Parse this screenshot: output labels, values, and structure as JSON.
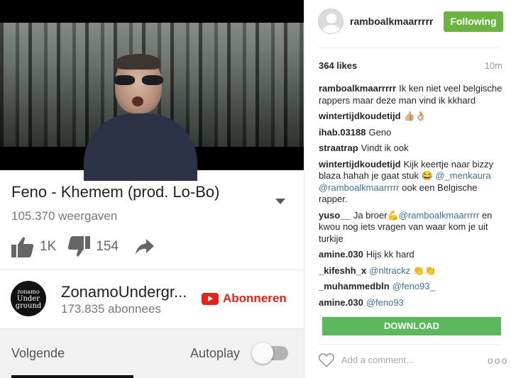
{
  "youtube": {
    "video_title": "Feno - Khemem (prod. Lo-Bo)",
    "views": "105.370 weergaven",
    "likes": "1K",
    "dislikes": "154",
    "channel": {
      "avatar_text_1": "zonamo",
      "avatar_text_2": "Under",
      "avatar_text_3": "ground",
      "name": "ZonamoUndergr...",
      "subscribers": "173.835 abonnees",
      "subscribe_label": "Abonneren"
    },
    "next_label": "Volgende",
    "autoplay_label": "Autoplay",
    "autoplay_on": false
  },
  "instagram": {
    "username": "ramboalkmaarrrrr",
    "follow_label": "Following",
    "likes": "364 likes",
    "time": "10m",
    "comments": [
      {
        "user": "ramboalkmaarrrrr",
        "text": "Ik ken niet veel belgische rappers maar deze man vind ik kkhard"
      },
      {
        "user": "wintertijdkoudetijd",
        "text": "👍🏼👌🏼"
      },
      {
        "user": "ihab.03188",
        "text": "Geno"
      },
      {
        "user": "straatrap",
        "text": "Vindt ik ook"
      },
      {
        "user": "wintertijdkoudetijd",
        "text": "Kijk keertje naar bizzy blaza hahah je gaat stuk 😂",
        "mentions": "@_menkaura @ramboalkmaarrrrr",
        "after": "ook een Belgische rapper."
      },
      {
        "user": "yuso__",
        "text": "Ja broer💪",
        "mentions": "@ramboalkmaarrrrr",
        "after": "en kwou nog iets vragen van waar kom je uit turkije"
      },
      {
        "user": "amine.030",
        "text": "Hijs kk hard"
      },
      {
        "user": "_kifeshh_x",
        "mentions": "@nltrackz",
        "after": "👏👏"
      },
      {
        "user": "_muhammedbln",
        "mentions": "@feno93_"
      },
      {
        "user": "amine.030",
        "mentions": "@feno93"
      }
    ],
    "download_label": "DOWNLOAD",
    "add_comment_placeholder": "Add a comment...",
    "more_label": "ooo"
  }
}
